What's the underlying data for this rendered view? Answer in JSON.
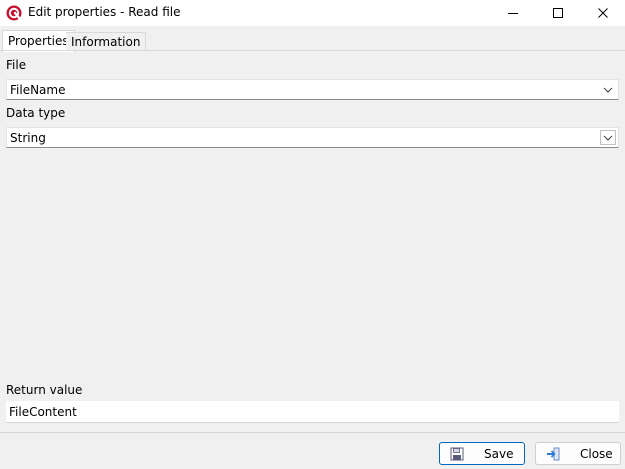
{
  "window": {
    "title": "Edit properties - Read file"
  },
  "tabs": [
    {
      "label": "Properties"
    },
    {
      "label": "Information"
    }
  ],
  "fields": {
    "file": {
      "label": "File",
      "value": "FileName"
    },
    "data_type": {
      "label": "Data type",
      "value": "String"
    },
    "return_value": {
      "label": "Return value",
      "value": "FileContent"
    }
  },
  "buttons": {
    "save": "Save",
    "close": "Close"
  },
  "colors": {
    "accent": "#0067c0",
    "icon_red": "#c8102e"
  }
}
